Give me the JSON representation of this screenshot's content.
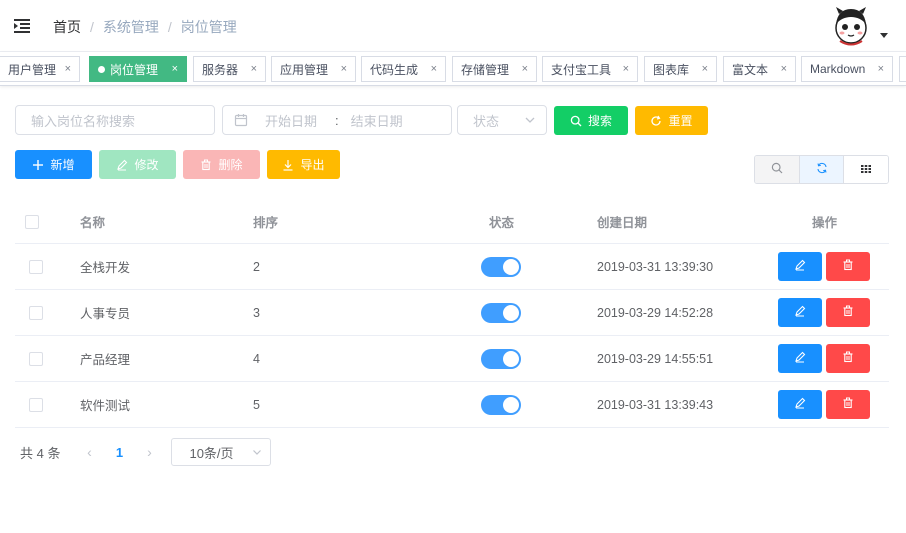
{
  "breadcrumb": [
    "首页",
    "系统管理",
    "岗位管理"
  ],
  "tags": [
    {
      "label": "用户管理",
      "active": false
    },
    {
      "label": "岗位管理",
      "active": true
    },
    {
      "label": "服务器",
      "active": false
    },
    {
      "label": "应用管理",
      "active": false
    },
    {
      "label": "代码生成",
      "active": false
    },
    {
      "label": "存储管理",
      "active": false
    },
    {
      "label": "支付宝工具",
      "active": false
    },
    {
      "label": "图表库",
      "active": false
    },
    {
      "label": "富文本",
      "active": false
    },
    {
      "label": "Markdown",
      "active": false
    }
  ],
  "tag_close": "×",
  "search": {
    "name_placeholder": "输入岗位名称搜索",
    "start_placeholder": "开始日期",
    "range_sep": ":",
    "end_placeholder": "结束日期",
    "status_placeholder": "状态",
    "search_label": "搜索",
    "reset_label": "重置"
  },
  "toolbar": {
    "add_label": "新增",
    "edit_label": "修改",
    "delete_label": "删除",
    "export_label": "导出"
  },
  "table": {
    "headers": {
      "name": "名称",
      "sort": "排序",
      "status": "状态",
      "created": "创建日期",
      "ops": "操作"
    },
    "rows": [
      {
        "name": "全栈开发",
        "sort": "2",
        "enabled": true,
        "created": "2019-03-31 13:39:30"
      },
      {
        "name": "人事专员",
        "sort": "3",
        "enabled": true,
        "created": "2019-03-29 14:52:28"
      },
      {
        "name": "产品经理",
        "sort": "4",
        "enabled": true,
        "created": "2019-03-29 14:55:51"
      },
      {
        "name": "软件测试",
        "sort": "5",
        "enabled": true,
        "created": "2019-03-31 13:39:43"
      }
    ]
  },
  "pagination": {
    "total_text": "共 4 条",
    "current_page": "1",
    "page_size": "10条/页"
  },
  "colors": {
    "primary": "#1890ff",
    "success": "#13ce66",
    "warning": "#ffba00",
    "danger": "#ff4949",
    "active_tag": "#42b983"
  }
}
